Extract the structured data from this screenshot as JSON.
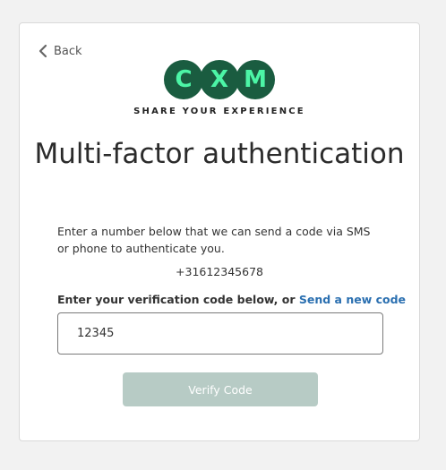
{
  "nav": {
    "back_label": "Back"
  },
  "logo": {
    "letters": [
      "C",
      "X",
      "M"
    ],
    "tagline": "SHARE YOUR EXPERIENCE"
  },
  "page": {
    "title": "Multi-factor authentication",
    "intro": "Enter a number below that we can send a code via SMS or phone to authenticate you.",
    "phone_number": "+31612345678"
  },
  "verification": {
    "label_prefix": "Enter your verification code below, or ",
    "send_new_code_link": "Send a new code",
    "code_value": "12345",
    "verify_button_label": "Verify Code"
  },
  "colors": {
    "logo_circle": "#1a5c40",
    "logo_letter": "#4cf5a6",
    "link": "#2a6fb0",
    "button_disabled": "#b7cbc5"
  }
}
